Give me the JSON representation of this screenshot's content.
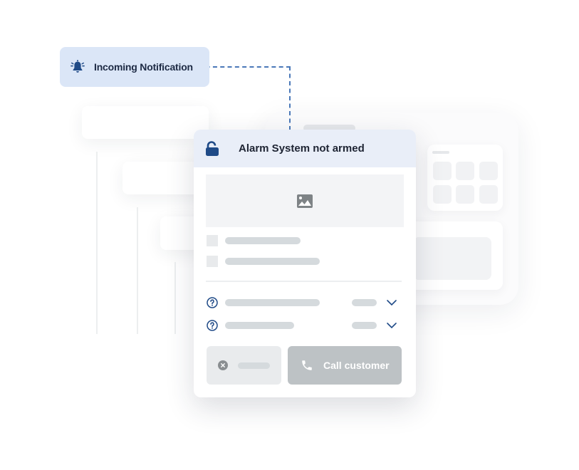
{
  "notification": {
    "icon": "bell-icon",
    "label": "Incoming Notification"
  },
  "card": {
    "header": {
      "icon": "unlocked-padlock-icon",
      "title": "Alarm System not armed"
    },
    "image_placeholder_icon": "image-icon",
    "rows": [
      {
        "icon": "help-circle-icon",
        "action_icon": "chevron-down-icon"
      },
      {
        "icon": "help-circle-icon",
        "action_icon": "chevron-down-icon"
      }
    ],
    "buttons": {
      "cancel_icon": "close-circle-icon",
      "call_label": "Call customer",
      "call_icon": "phone-icon"
    }
  },
  "colors": {
    "accent": "#1f4a87",
    "notification_bg": "#dbe6f7",
    "header_bg": "#e9eef8",
    "connector": "#4a78b8",
    "call_button_bg": "#bdc2c5"
  }
}
